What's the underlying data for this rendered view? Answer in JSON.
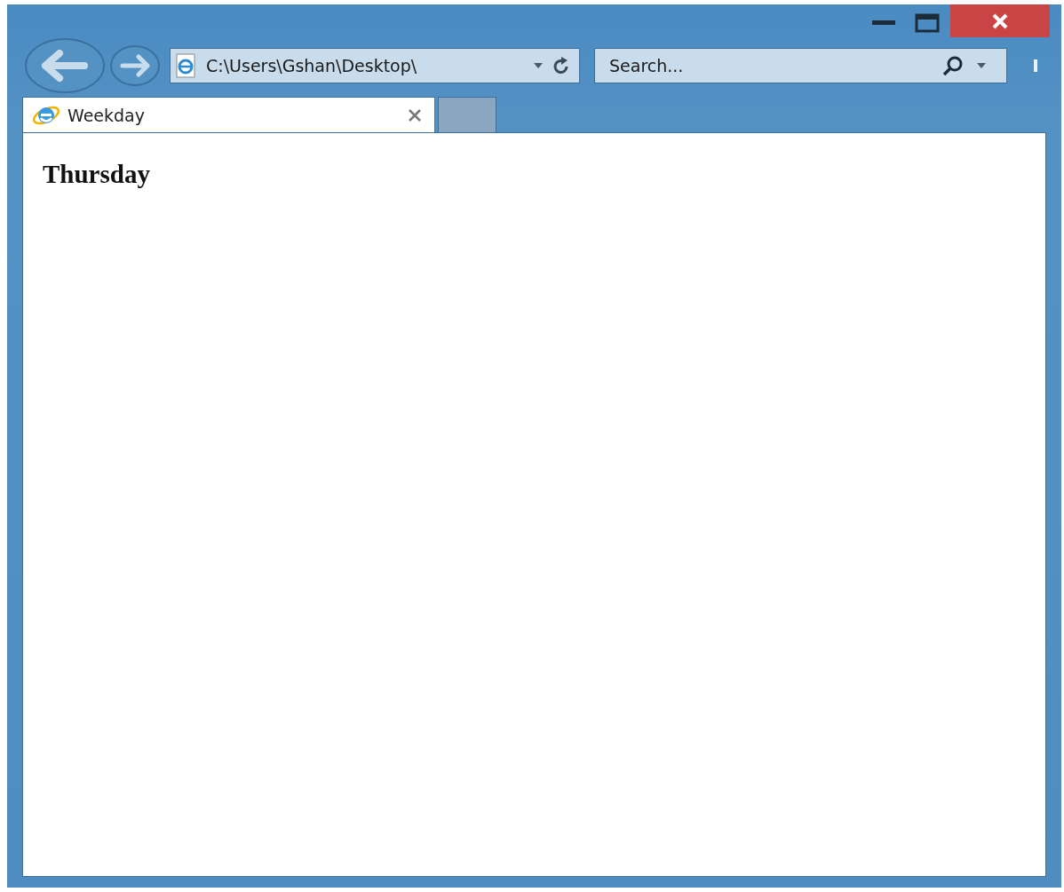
{
  "address_bar": {
    "value": "C:\\Users\\Gshan\\Desktop\\"
  },
  "search": {
    "placeholder": "Search..."
  },
  "tabs": [
    {
      "label": "Weekday",
      "selected": true
    }
  ],
  "page": {
    "heading": "Thursday"
  }
}
